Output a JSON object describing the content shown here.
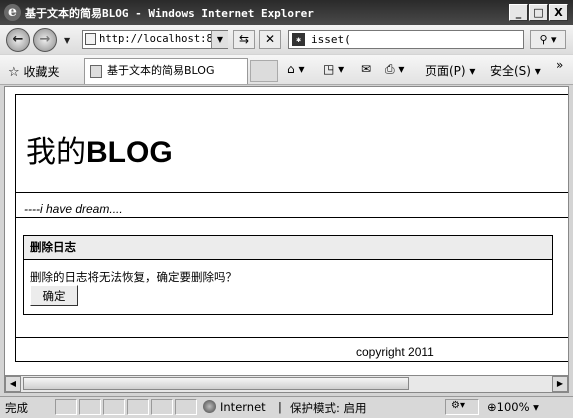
{
  "window": {
    "title": "基于文本的简易BLOG - Windows Internet Explorer",
    "minimize": "_",
    "maximize": "□",
    "close": "X"
  },
  "address_bar": {
    "url": "http://localhost:8",
    "search_value": "isset("
  },
  "favorites_bar": {
    "favorites_label": "收藏夹",
    "tab_title": "基于文本的简易BLOG",
    "page_menu": "页面(P)",
    "safety_menu": "安全(S)"
  },
  "page": {
    "heading_prefix": "我的",
    "heading_bold": "BLOG",
    "tagline": "----i have dream....",
    "dialog_title": "删除日志",
    "dialog_message": "删除的日志将无法恢复，确定要删除吗？",
    "confirm_button": "确定",
    "copyright": "copyright 2011"
  },
  "status_bar": {
    "status": "完成",
    "zone": "Internet",
    "protected_mode": "保护模式: 启用",
    "zoom": "100%"
  }
}
